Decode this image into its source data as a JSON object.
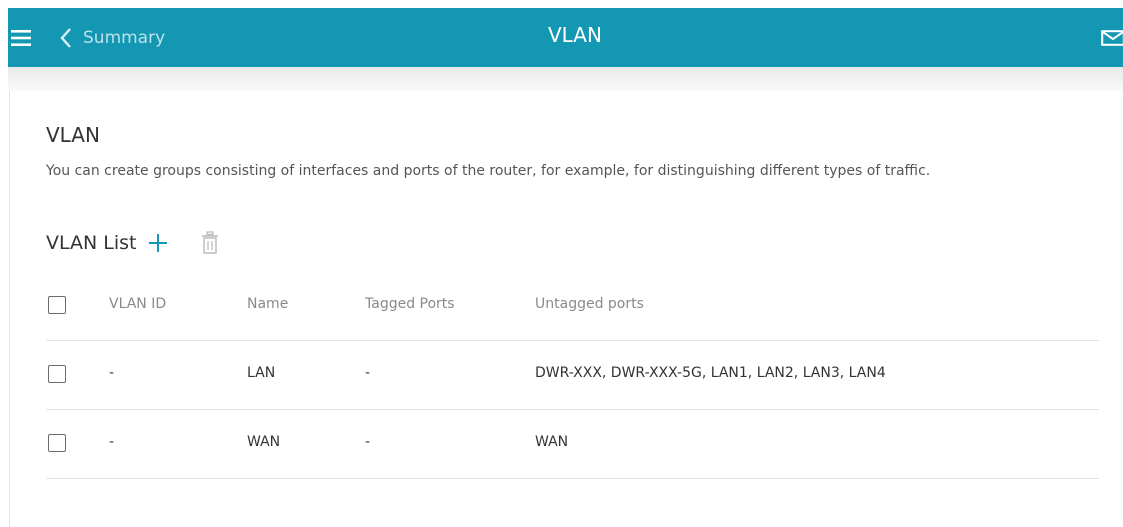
{
  "header": {
    "back_label": "Summary",
    "title": "VLAN",
    "icons": {
      "menu": "hamburger-menu-icon",
      "back": "chevron-left-icon",
      "notifications": "envelope-icon"
    },
    "colors": {
      "bar": "#1397b2",
      "text": "#ffffff"
    }
  },
  "section": {
    "title": "VLAN",
    "description": "You can create groups consisting of interfaces and ports of the router, for example, for distinguishing different types of traffic."
  },
  "vlan_list": {
    "title": "VLAN List",
    "icons": {
      "add": "plus-icon",
      "delete": "trash-icon"
    },
    "columns": {
      "vlan_id": "VLAN ID",
      "name": "Name",
      "tagged": "Tagged Ports",
      "untagged": "Untagged ports"
    },
    "rows": [
      {
        "vlan_id": "-",
        "name": "LAN",
        "tagged": "-",
        "untagged": "DWR-XXX, DWR-XXX-5G, LAN1, LAN2, LAN3, LAN4"
      },
      {
        "vlan_id": "-",
        "name": "WAN",
        "tagged": "-",
        "untagged": "WAN"
      }
    ]
  }
}
